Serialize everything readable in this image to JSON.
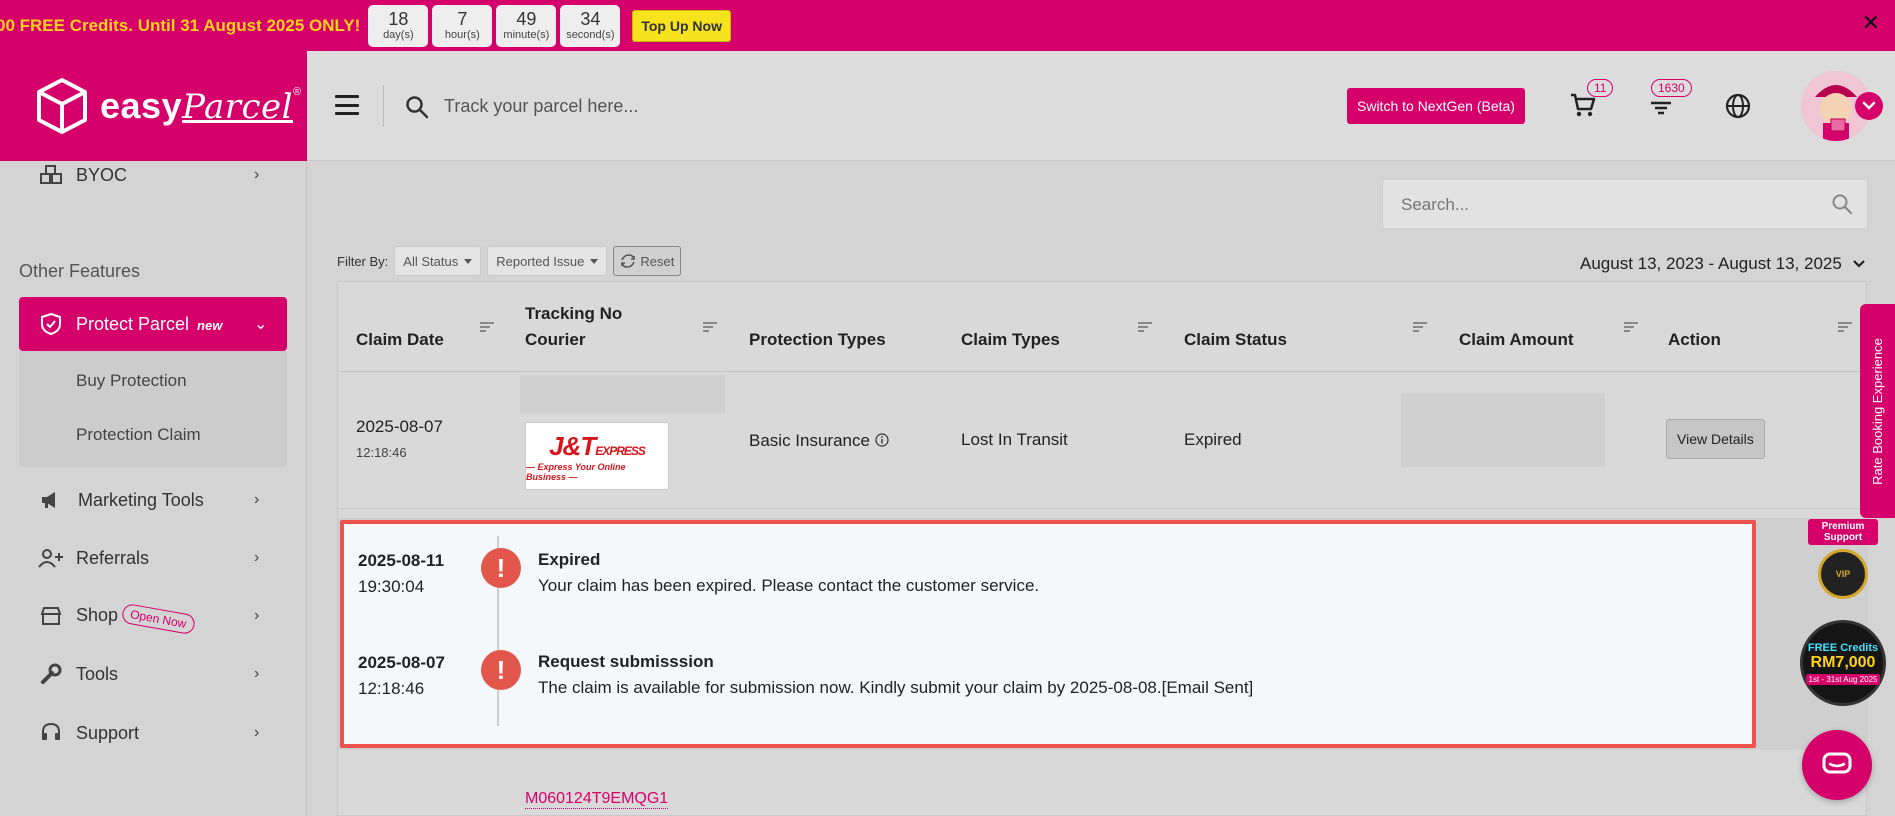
{
  "promo": {
    "text": "00 FREE Credits. Until 31 August 2025 ONLY!",
    "countdown": [
      {
        "value": "18",
        "unit": "day(s)"
      },
      {
        "value": "7",
        "unit": "hour(s)"
      },
      {
        "value": "49",
        "unit": "minute(s)"
      },
      {
        "value": "34",
        "unit": "second(s)"
      }
    ],
    "topup_label": "Top Up Now",
    "close_glyph": "✕"
  },
  "logo": {
    "text_bold": "easy",
    "text_script": "Parcel",
    "reg": "®"
  },
  "header": {
    "track_placeholder": "Track your parcel here...",
    "nextgen_label": "Switch to NextGen (Beta)",
    "cart_count": "11",
    "notification_count": "1630"
  },
  "sidebar": {
    "byoc": "BYOC",
    "section_title": "Other Features",
    "protect_parcel": "Protect Parcel",
    "new_tag": "new",
    "sub_items": [
      "Buy Protection",
      "Protection Claim"
    ],
    "marketing_tools": "Marketing Tools",
    "referrals": "Referrals",
    "shop": "Shop",
    "open_now": "Open Now",
    "tools": "Tools",
    "support": "Support"
  },
  "main": {
    "search_placeholder": "Search...",
    "filter_label": "Filter By:",
    "status_filter": "All Status",
    "issue_filter": "Reported Issue",
    "reset_label": "Reset",
    "date_range": "August 13, 2023 - August 13, 2025"
  },
  "table": {
    "headers": {
      "claim_date": "Claim Date",
      "tracking": "Tracking No",
      "courier": "Courier",
      "protection_types": "Protection Types",
      "claim_types": "Claim Types",
      "claim_status": "Claim Status",
      "claim_amount": "Claim Amount",
      "action": "Action"
    },
    "row1": {
      "date": "2025-08-07",
      "time": "12:18:46",
      "courier_logo_main": "J&T",
      "courier_logo_small": "EXPRESS",
      "courier_logo_sub": "— Express Your Online Business —",
      "protection_type": "Basic Insurance",
      "claim_type": "Lost In Transit",
      "claim_status": "Expired",
      "action_label": "View Details"
    },
    "timeline": [
      {
        "date": "2025-08-11",
        "time": "19:30:04",
        "title": "Expired",
        "desc": "Your claim has been expired. Please contact the customer service."
      },
      {
        "date": "2025-08-07",
        "time": "12:18:46",
        "title": "Request submisssion",
        "desc": "The claim is available for submission now. Kindly submit your claim by 2025-08-08.[Email Sent]"
      }
    ],
    "row3_tracking": "M060124T9EMQG1"
  },
  "widgets": {
    "rate_booking": "Rate Booking Experience",
    "premium_support": "Premium Support",
    "vip": "VIP",
    "credits_line1": "FREE Credits",
    "credits_line2": "RM7,000",
    "credits_line3": "1st - 31st Aug 2025"
  },
  "colors": {
    "brand": "#d6006b",
    "promo_text": "#ffd21a",
    "alert_red": "#e2564c"
  }
}
